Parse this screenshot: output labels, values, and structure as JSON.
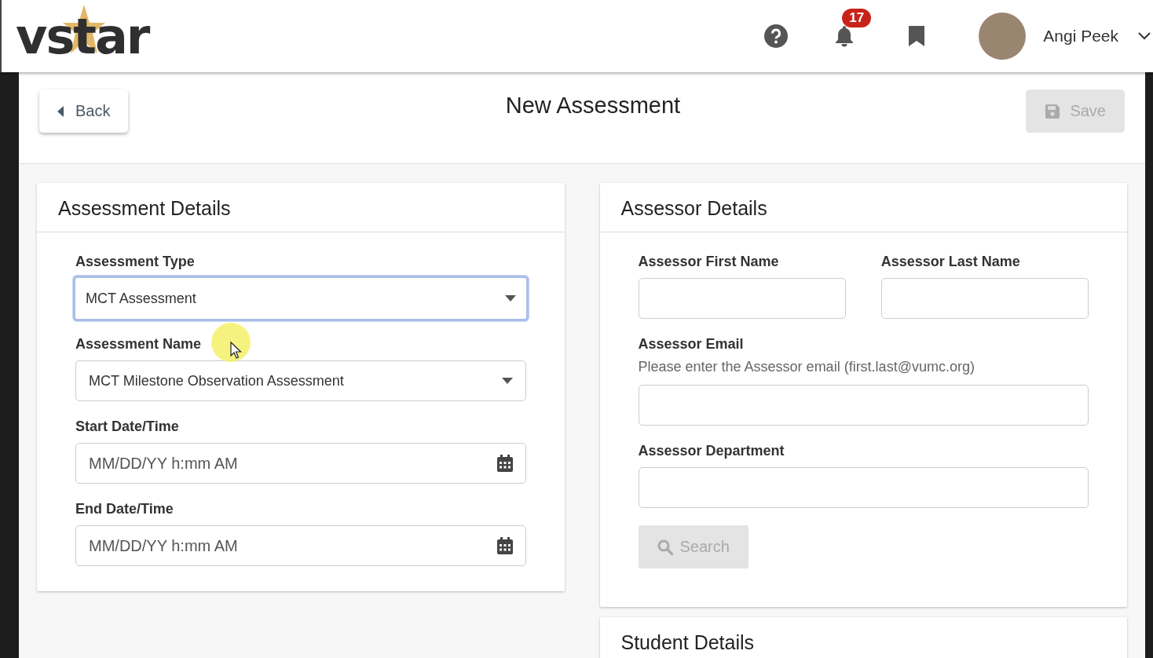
{
  "header": {
    "logo": "vstar",
    "notification_count": "17",
    "user_name": "Angi Peek"
  },
  "toolbar": {
    "back": "Back",
    "title": "New Assessment",
    "save": {
      "label": "Save",
      "disabled": true
    }
  },
  "assessment_details": {
    "title": "Assessment Details",
    "fields": [
      {
        "kind": "select",
        "label": "Assessment Type",
        "value": "MCT Assessment",
        "focused": true
      },
      {
        "kind": "select",
        "label": "Assessment Name",
        "value": "MCT Milestone Observation Assessment",
        "focused": false
      },
      {
        "kind": "date",
        "label": "Start Date/Time",
        "placeholder": "MM/DD/YY h:mm AM",
        "focused": false
      },
      {
        "kind": "date",
        "label": "End Date/Time",
        "placeholder": "MM/DD/YY h:mm AM",
        "focused": false
      }
    ]
  },
  "assessor_details": {
    "title": "Assessor Details",
    "rows": [
      [
        {
          "kind": "text",
          "label": "Assessor First Name",
          "focused": false
        },
        {
          "kind": "text",
          "label": "Assessor Last Name",
          "focused": false
        }
      ],
      [
        {
          "kind": "text",
          "label": "Assessor Email",
          "hint": "Please enter the Assessor email (first.last@vumc.org)",
          "focused": false
        }
      ],
      [
        {
          "kind": "text",
          "label": "Assessor Department",
          "focused": false
        }
      ]
    ],
    "search": {
      "label": "Search",
      "disabled": true
    }
  },
  "student_details": {
    "title": "Student Details"
  }
}
